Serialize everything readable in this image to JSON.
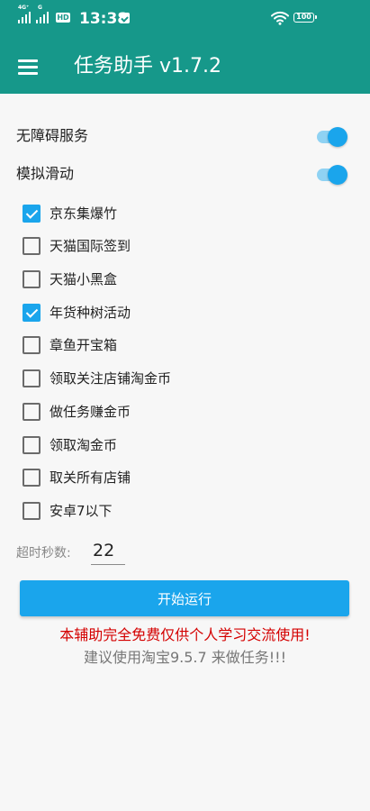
{
  "status_bar": {
    "network_top": "4G⁺",
    "network_2": "G",
    "hd_badge": "HD",
    "time": "13:38",
    "battery": "100"
  },
  "app_bar": {
    "title": "任务助手 v1.7.2",
    "menu_icon": "menu-icon"
  },
  "switches": [
    {
      "label": "无障碍服务",
      "on": true
    },
    {
      "label": "模拟滑动",
      "on": true
    }
  ],
  "tasks": [
    {
      "label": "京东集爆竹",
      "checked": true
    },
    {
      "label": "天猫国际签到",
      "checked": false
    },
    {
      "label": "天猫小黑盒",
      "checked": false
    },
    {
      "label": "年货种树活动",
      "checked": true
    },
    {
      "label": "章鱼开宝箱",
      "checked": false
    },
    {
      "label": "领取关注店铺淘金币",
      "checked": false
    },
    {
      "label": "做任务赚金币",
      "checked": false
    },
    {
      "label": "领取淘金币",
      "checked": false
    },
    {
      "label": "取关所有店铺",
      "checked": false
    },
    {
      "label": "安卓7以下",
      "checked": false
    }
  ],
  "timeout": {
    "label": "超时秒数:",
    "value": "22"
  },
  "start_button": {
    "label": "开始运行"
  },
  "notices": {
    "red": "本辅助完全免费仅供个人学习交流使用!",
    "gray": "建议使用淘宝9.5.7 来做任务!!!"
  },
  "colors": {
    "app_bar": "#16988a",
    "accent": "#1aa5ec",
    "notice_red": "#d40000"
  }
}
